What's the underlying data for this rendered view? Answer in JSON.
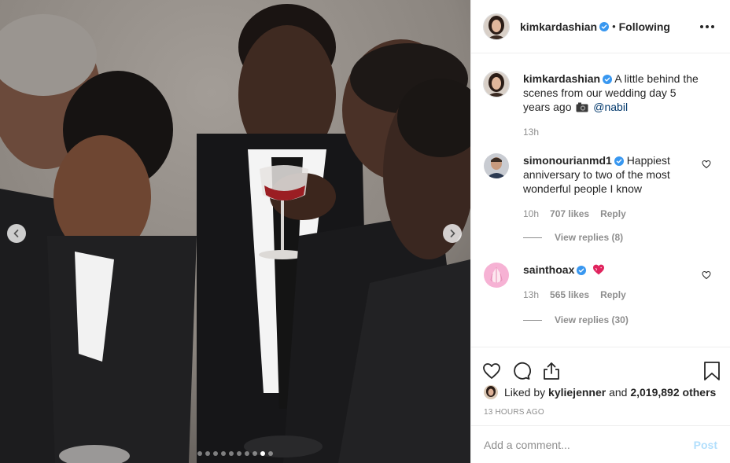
{
  "post": {
    "author": {
      "username": "kimkardashian",
      "verified": true,
      "follow_status": "Following",
      "avatar_icon": "user-avatar-icon"
    },
    "carousel": {
      "total_slides": 10,
      "active_slide": 9,
      "prev_icon": "chevron-left-icon",
      "next_icon": "chevron-right-icon"
    },
    "caption": {
      "username": "kimkardashian",
      "text": "A little behind the scenes from our wedding day 5 years ago",
      "emoji": "camera-icon",
      "mention": "@nabil",
      "time": "13h"
    },
    "comments": [
      {
        "username": "simonourianmd1",
        "verified": true,
        "text": "Happiest anniversary to two of the most wonderful people I know",
        "time": "10h",
        "likes": "707 likes",
        "reply_label": "Reply",
        "view_replies": "View replies (8)"
      },
      {
        "username": "sainthoax",
        "verified": true,
        "text": "",
        "emoji": "sparkling-heart-icon",
        "time": "13h",
        "likes": "565 likes",
        "reply_label": "Reply",
        "view_replies": "View replies (30)"
      }
    ],
    "likes": {
      "prefix": "Liked by",
      "first_user": "kyliejenner",
      "conjunction": "and",
      "others": "2,019,892 others"
    },
    "time_ago": "13 hours ago",
    "add_comment": {
      "placeholder": "Add a comment...",
      "post_label": "Post"
    },
    "colors": {
      "verified_blue": "#3897f0",
      "link": "#00376b",
      "muted": "#8e8e8e",
      "post_button_disabled": "#b2dffc",
      "border": "#efefef"
    }
  }
}
